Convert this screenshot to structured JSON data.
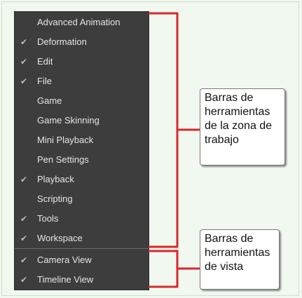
{
  "menu": {
    "items": [
      {
        "label": "Advanced Animation",
        "checked": false
      },
      {
        "label": "Deformation",
        "checked": true
      },
      {
        "label": "Edit",
        "checked": true
      },
      {
        "label": "File",
        "checked": true
      },
      {
        "label": "Game",
        "checked": false
      },
      {
        "label": "Game Skinning",
        "checked": false
      },
      {
        "label": "Mini Playback",
        "checked": false
      },
      {
        "label": "Pen Settings",
        "checked": false
      },
      {
        "label": "Playback",
        "checked": true
      },
      {
        "label": "Scripting",
        "checked": false
      },
      {
        "label": "Tools",
        "checked": true
      },
      {
        "label": "Workspace",
        "checked": true
      }
    ],
    "view_items": [
      {
        "label": "Camera View",
        "checked": true
      },
      {
        "label": "Timeline View",
        "checked": true
      }
    ],
    "check_glyph": "✔"
  },
  "callouts": {
    "workspace": [
      "Barras de",
      "herramientas",
      "de la zona de",
      "trabajo"
    ],
    "view": [
      "Barras de",
      "herramientas",
      "de vista"
    ]
  },
  "colors": {
    "bracket": "#d9282e",
    "menu_bg": "#3d3d3d",
    "page_bg": "#f1f8ef"
  }
}
